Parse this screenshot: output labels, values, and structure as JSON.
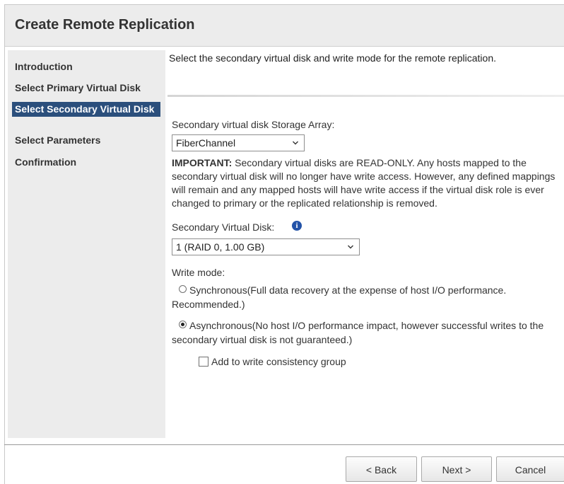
{
  "dialog": {
    "title": "Create Remote Replication"
  },
  "sidebar": {
    "items": [
      {
        "label": "Introduction"
      },
      {
        "label": "Select Primary Virtual Disk"
      },
      {
        "label": "Select Secondary Virtual Disk",
        "active": true
      },
      {
        "label": "Select Parameters"
      },
      {
        "label": "Confirmation"
      }
    ]
  },
  "content": {
    "intro": "Select the secondary virtual disk and write mode for the remote replication.",
    "storage_array": {
      "label": "Secondary virtual disk Storage Array:",
      "selected": "FiberChannel"
    },
    "important": {
      "prefix": "IMPORTANT:",
      "text": " Secondary virtual disks are READ-ONLY. Any hosts mapped to the secondary virtual disk will no longer have write access. However, any defined mappings will remain and any mapped hosts will have write access if the virtual disk role is ever changed to primary or the replicated relationship is removed."
    },
    "secondary_disk": {
      "label": "Secondary Virtual Disk:",
      "selected": "1 (RAID 0, 1.00 GB)",
      "info_icon": "info-icon"
    },
    "write_mode": {
      "label": "Write mode:",
      "options": [
        {
          "label": "Synchronous(Full data recovery at the expense of host I/O performance. Recommended.)",
          "selected": false
        },
        {
          "label": "Asynchronous(No host I/O performance impact, however successful writes to the secondary virtual disk is not guaranteed.)",
          "selected": true
        }
      ],
      "consistency_group": {
        "label": "Add to write consistency group",
        "checked": false
      }
    }
  },
  "footer": {
    "back_label": "< Back",
    "next_label": "Next >",
    "cancel_label": "Cancel"
  }
}
